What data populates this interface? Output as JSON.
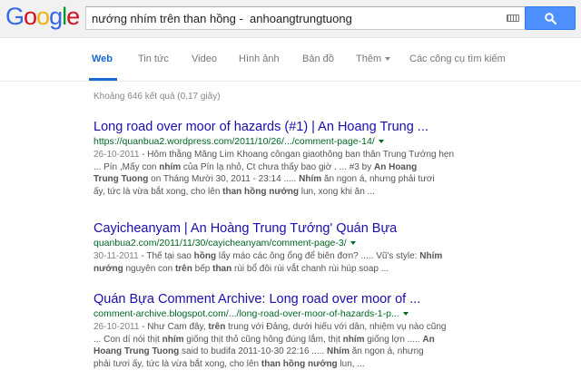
{
  "logo": {
    "letters": [
      "G",
      "o",
      "o",
      "g",
      "l",
      "e"
    ],
    "colors": [
      "#3369e8",
      "#d50f25",
      "#eeb211",
      "#3369e8",
      "#009925",
      "#d50f25"
    ]
  },
  "search": {
    "query": "nướng nhím trên than hồng -  anhoangtrungtuong"
  },
  "tabs": [
    {
      "label": "Web"
    },
    {
      "label": "Tin tức"
    },
    {
      "label": "Video"
    },
    {
      "label": "Hình ảnh"
    },
    {
      "label": "Bản đồ"
    },
    {
      "label": "Thêm"
    },
    {
      "label": "Các công cụ tìm kiếm"
    }
  ],
  "stats": "Khoảng 646 kết quả (0,17 giây)",
  "results": [
    {
      "title": "Long road over moor of hazards (#1) | An Hoang Trung ...",
      "url": "https://quanbua2.wordpress.com/2011/10/26/.../comment-page-14/",
      "date": "26-10-2011",
      "snippet_lines": [
        [
          {
            "t": " - Hôm thằng Măng Lim Khoang côngan giaothông ban thân Trung Tướng hẹn"
          }
        ],
        [
          {
            "t": "... Pín ,Mấy con "
          },
          {
            "b": "nhím"
          },
          {
            "t": " của Pín lạ nhỏ, Ct chưa thấy bao giờ . ... #3 by "
          },
          {
            "b": "An Hoang"
          }
        ],
        [
          {
            "b": "Trung Tuong"
          },
          {
            "t": " on Tháng Mười 30, 2011 - 23:14 ..... "
          },
          {
            "b": "Nhím"
          },
          {
            "t": " ăn ngon á, nhưng phải tươi"
          }
        ],
        [
          {
            "t": "ấy, tức là vừa bắt xong, cho lên "
          },
          {
            "b": "than hồng nướng"
          },
          {
            "t": " lun, xong khi ăn ..."
          }
        ]
      ]
    },
    {
      "title": "Cayicheanyam | An Hoàng Trung Tướng' Quán Bựa",
      "url": "quanbua2.com/2011/11/30/cayicheanyam/comment-page-3/",
      "date": "30-11-2011",
      "snippet_lines": [
        [
          {
            "t": " - Thế tại sao "
          },
          {
            "b": "hồng"
          },
          {
            "t": " lấy máo các ông ổng để biên đơn? ..... Vũ's style: "
          },
          {
            "b": "Nhím"
          }
        ],
        [
          {
            "b": "nướng"
          },
          {
            "t": " nguyên con "
          },
          {
            "b": "trên"
          },
          {
            "t": " bếp "
          },
          {
            "b": "than"
          },
          {
            "t": " rùi bổ đôi rùi vắt chanh rùi húp soap ..."
          }
        ]
      ]
    },
    {
      "title": "Quán Bựa Comment Archive: Long road over moor of ...",
      "url": "comment-archive.blogspot.com/.../long-road-over-moor-of-hazards-1-p...",
      "date": "26-10-2011",
      "snippet_lines": [
        [
          {
            "t": " - Như Cam đây, "
          },
          {
            "b": "trên"
          },
          {
            "t": " trung với Đảng, dưới hiếu với dân, nhiệm vụ nào cũng"
          }
        ],
        [
          {
            "t": "... Con dí nói thịt "
          },
          {
            "b": "nhím"
          },
          {
            "t": " giống thịt thỏ cũng hông đúng lắm, thịt "
          },
          {
            "b": "nhím"
          },
          {
            "t": " giống lợn ..... "
          },
          {
            "b": "An"
          }
        ],
        [
          {
            "b": "Hoang Trung Tuong"
          },
          {
            "t": " said to budifa 2011-10-30 22:16 ..... "
          },
          {
            "b": "Nhím"
          },
          {
            "t": " ăn ngon á, nhưng"
          }
        ],
        [
          {
            "t": "phải tươi ấy, tức là vừa bắt xong, cho lên "
          },
          {
            "b": "than hồng nướng"
          },
          {
            "t": " lun, ..."
          }
        ]
      ]
    }
  ]
}
